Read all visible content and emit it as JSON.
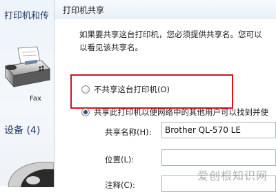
{
  "background_window": {
    "title": "打印机和传",
    "fax_label": "Fax",
    "devices_section": "设备 (4)"
  },
  "dialog": {
    "tab_title": "打印机共享",
    "description": "如果要共享这台打印机，您必须提供共享名。您可以\n以看见该共享名。",
    "option_no_share": "不共享这台打印机(O)",
    "option_share": "共享此打印机以便网络中的其他用户可以找到并使",
    "option_no_share_checked": false,
    "option_share_checked": true,
    "share_name_label": "共享名称(H):",
    "share_name_value": "Brother QL-570 LE",
    "location_label": "位置(L):",
    "location_value": "",
    "comment_label": "注释(C):",
    "comment_value": ""
  },
  "annotation": {
    "highlight_color": "#c8181e"
  },
  "watermark": {
    "text": "爱创根知识网"
  }
}
